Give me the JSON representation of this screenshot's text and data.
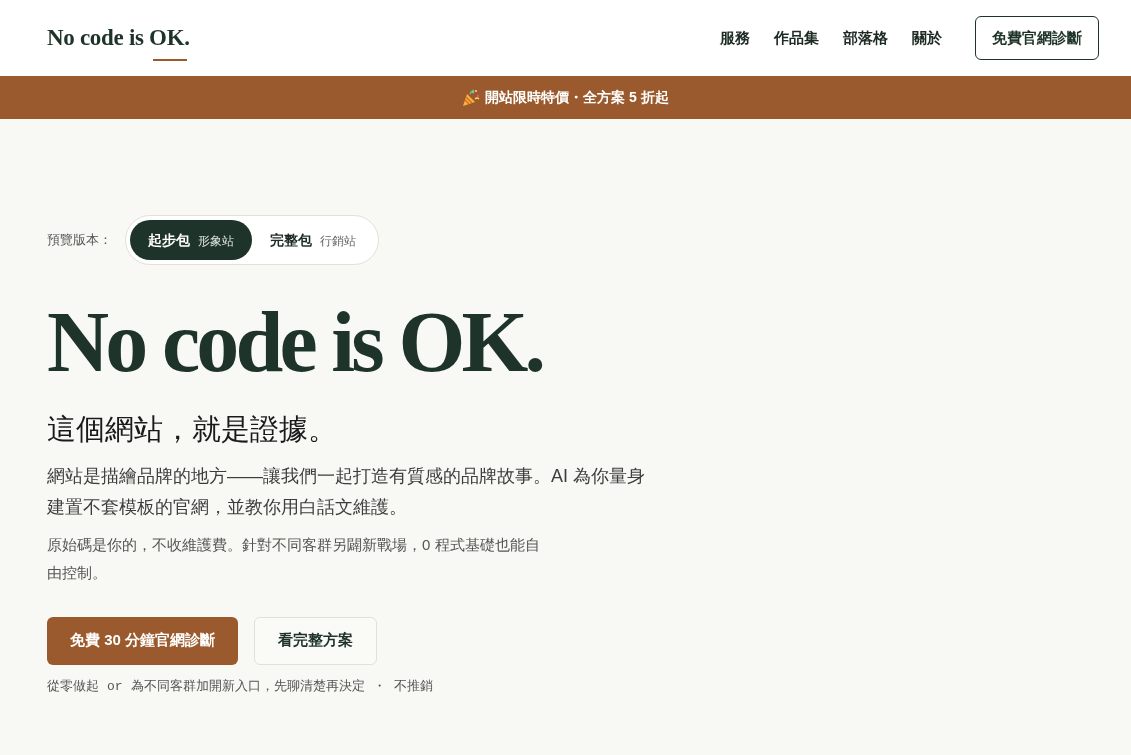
{
  "header": {
    "logo": "No code is OK.",
    "nav": [
      {
        "label": "服務"
      },
      {
        "label": "作品集"
      },
      {
        "label": "部落格"
      },
      {
        "label": "關於"
      }
    ],
    "cta": "免費官網診斷"
  },
  "banner": {
    "text": "開站限時特價・全方案 5 折起"
  },
  "preview": {
    "label": "預覽版本：",
    "options": [
      {
        "name": "起步包",
        "tag": "形象站",
        "selected": true
      },
      {
        "name": "完整包",
        "tag": "行銷站",
        "selected": false
      }
    ]
  },
  "hero": {
    "title": "No code is OK.",
    "subtitle": "這個網站，就是證據。",
    "lead": "網站是描繪品牌的地方——讓我們一起打造有質感的品牌故事。AI 為你量身建置不套模板的官網，並教你用白話文維護。",
    "detail": "原始碼是你的，不收維護費。針對不同客群另闢新戰場，0 程式基礎也能自由控制。",
    "buttons": [
      {
        "label": "免費 30 分鐘官網診斷",
        "kind": "primary"
      },
      {
        "label": "看完整方案",
        "kind": "secondary"
      }
    ],
    "note": [
      {
        "kind": "text",
        "text": "從零做起"
      },
      {
        "kind": "code",
        "text": "or"
      },
      {
        "kind": "text",
        "text": "為不同客群加開新入口，先聊清楚再決定"
      },
      {
        "kind": "separator",
        "text": "・"
      },
      {
        "kind": "text",
        "text": "不推銷"
      }
    ]
  }
}
